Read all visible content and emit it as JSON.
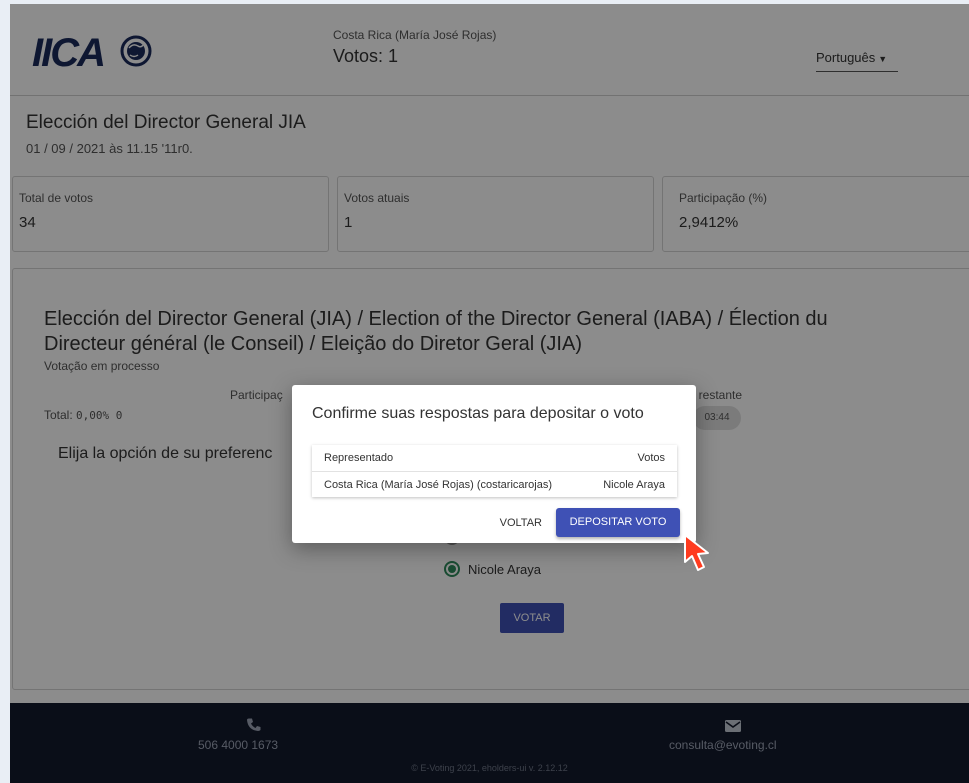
{
  "header": {
    "logo_text": "IICA",
    "voter_name": "Costa Rica (María José Rojas)",
    "votes_line": "Votos: 1",
    "language": "Português"
  },
  "election": {
    "title": "Elección del Director General JIA",
    "datetime": "01 / 09 / 2021 às 11.15 '11r0."
  },
  "stats": [
    {
      "label": "Total de votos",
      "value": "34"
    },
    {
      "label": "Votos atuais",
      "value": "1"
    },
    {
      "label": "Participação (%)",
      "value": "2,9412%"
    }
  ],
  "question": {
    "title": "Elección del Director General (JIA) / Election of the Director General (IABA) / Élection du Directeur général (le Conseil) / Eleição do Diretor Geral (JIA)",
    "status": "Votação em processo",
    "participation_label": "Participaç",
    "total_label": "Total:",
    "total_value": "0,00% 0",
    "time_label": "po restante",
    "time_value": "03:44",
    "instruction": "Elija la opción de su preferenc",
    "option_selected": "Nicole Araya",
    "vote_button": "VOTAR"
  },
  "modal": {
    "title": "Confirme suas respostas para depositar o voto",
    "col_represented": "Representado",
    "col_votes": "Votos",
    "row_represented": "Costa Rica (María José Rojas) (costaricarojas)",
    "row_vote": "Nicole Araya",
    "back_button": "VOLTAR",
    "confirm_button": "DEPOSITAR VOTO"
  },
  "footer": {
    "phone": "506 4000 1673",
    "email": "consulta@evoting.cl",
    "copyright": "© E-Voting 2021, eholders-ui v. 2.12.12"
  },
  "colors": {
    "primary": "#3f51b5",
    "radio_selected": "#2f8a5b",
    "footer_bg": "#131a2c",
    "cursor": "#ff3b1f"
  },
  "icons": [
    "phone-icon",
    "mail-icon",
    "chevron-down-icon",
    "cursor-icon"
  ]
}
